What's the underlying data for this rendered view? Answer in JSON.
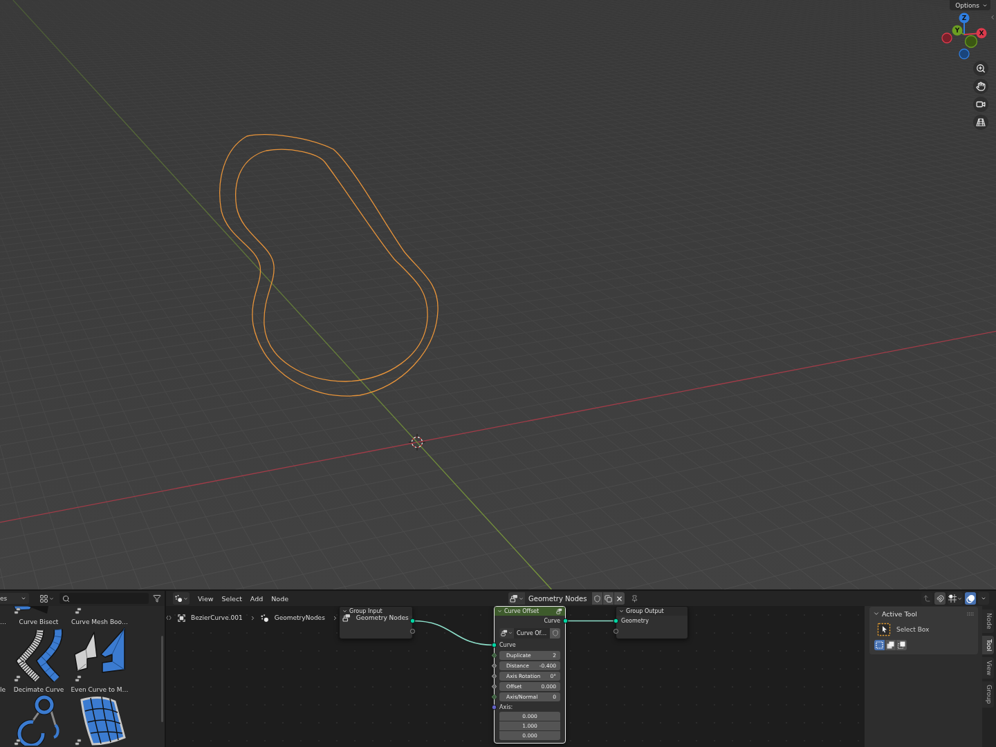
{
  "viewport": {
    "options_menu": "Options",
    "gizmo_axes": [
      {
        "label": "Z",
        "color": "#2f7ee0"
      },
      {
        "label": "Y",
        "color": "#6b9e22"
      },
      {
        "label": "X",
        "color": "#dc3a4c"
      }
    ]
  },
  "asset_browser": {
    "library": "es",
    "rows": [
      {
        "items": [
          {
            "label": "…"
          },
          {
            "label": "Curve Bisect",
            "kind": "bisect"
          },
          {
            "label": "Curve Mesh Boo…",
            "kind": "boolean"
          }
        ]
      },
      {
        "items": [
          {
            "label": "le"
          },
          {
            "label": "Decimate Curve",
            "kind": "decimate"
          },
          {
            "label": "Even Curve to M…",
            "kind": "even"
          }
        ]
      },
      {
        "items": [
          {
            "kind": "loop"
          },
          {
            "kind": "patch"
          }
        ]
      }
    ]
  },
  "node_editor": {
    "menus": [
      "View",
      "Select",
      "Add",
      "Node"
    ],
    "node_tree": {
      "name": "Geometry Nodes",
      "fake_user": false,
      "pinned": false
    },
    "header_tools": [
      {
        "kind": "parent",
        "disabled": true
      },
      {
        "kind": "snap",
        "on": false
      },
      {
        "kind": "snap_mode"
      },
      {
        "kind": "overlays",
        "on": true
      }
    ],
    "breadcrumbs": [
      {
        "kind": "object",
        "label": "BezierCurve.001"
      },
      {
        "kind": "modifier",
        "label": "GeometryNodes"
      },
      {
        "kind": "node_tree",
        "label": "Geometry Nodes"
      }
    ],
    "group_input": {
      "title": "Group Input",
      "selected": false,
      "outputs": [
        {
          "kind": "geometry"
        },
        {
          "kind": "virtual"
        }
      ]
    },
    "curve_offset": {
      "title": "Curve Offset",
      "selected": true,
      "outputs": [
        {
          "label": "Curve",
          "kind": "geometry"
        }
      ],
      "datablock": {
        "name": "Curve Of…",
        "fake_user": false
      },
      "inputs": [
        {
          "label": "Curve",
          "kind": "geometry"
        },
        {
          "label": "Duplicate",
          "value": "2",
          "kind": "int"
        },
        {
          "label": "Distance",
          "value": "-0.400",
          "kind": "float"
        },
        {
          "label": "Axis Rotation",
          "value": "0°",
          "kind": "float"
        },
        {
          "label": "Offset",
          "value": "0.000",
          "kind": "float"
        },
        {
          "label": "Axis/Normal",
          "value": "0",
          "kind": "int"
        },
        {
          "label": "Axis:",
          "kind": "vector",
          "values": [
            "0.000",
            "1.000",
            "0.000"
          ]
        }
      ]
    },
    "group_output": {
      "title": "Group Output",
      "selected": false,
      "inputs": [
        {
          "label": "Geometry",
          "kind": "geometry"
        },
        {
          "kind": "virtual"
        }
      ]
    }
  },
  "sidebar": {
    "panel": {
      "title": "Active Tool",
      "expanded": true,
      "tool": "Select Box",
      "modes": [
        {
          "kind": "set",
          "selected": true
        },
        {
          "kind": "extend",
          "selected": false
        },
        {
          "kind": "subtract",
          "selected": false
        }
      ]
    },
    "tabs": [
      {
        "label": "Node",
        "selected": false
      },
      {
        "label": "Tool",
        "selected": true
      },
      {
        "label": "View",
        "selected": false
      },
      {
        "label": "Group",
        "selected": false
      }
    ]
  }
}
